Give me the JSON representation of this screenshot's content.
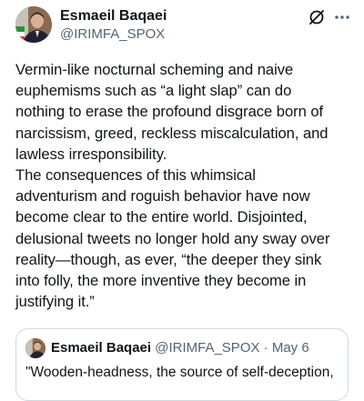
{
  "author": {
    "name": "Esmaeil Baqaei",
    "handle": "@IRIMFA_SPOX"
  },
  "icons": {
    "avatar": "avatar-photo",
    "grok": "grok-icon",
    "more": "more-options-icon"
  },
  "tweet": {
    "text": "Vermin-like nocturnal scheming and naive\neuphemisms such as “a light slap” can do\nnothing to erase the profound disgrace born of\nnarcissism, greed, reckless miscalculation, and\nlawless irresponsibility.\nThe consequences of this whimsical\nadventurism and roguish behavior have now\nbecome clear to the entire world. Disjointed,\ndelusional tweets no longer hold any sway over\nreality—though, as ever, “the deeper they sink\ninto folly, the more inventive they become in\njustifying it.”"
  },
  "quote": {
    "name": "Esmaeil Baqaei",
    "handle": "@IRIMFA_SPOX",
    "separator": "·",
    "date": "May 6",
    "text": "\"Wooden-headness, the source of self-deception,"
  },
  "colors": {
    "text": "#0f1419",
    "secondary": "#536471",
    "border": "#cfd9de"
  }
}
